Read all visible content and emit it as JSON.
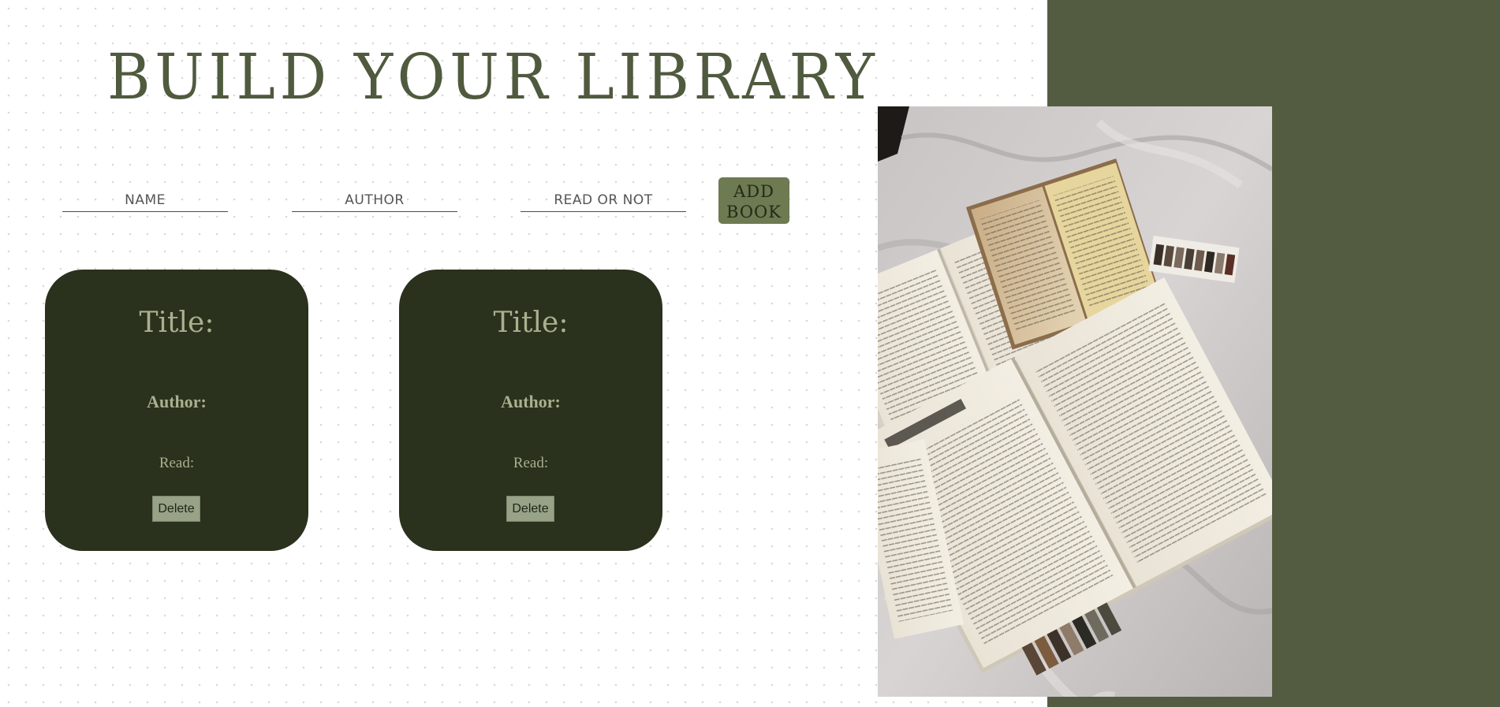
{
  "header": {
    "title": "BUILD YOUR LIBRARY"
  },
  "form": {
    "name_placeholder": "NAME",
    "author_placeholder": "AUTHOR",
    "read_placeholder": "READ OR NOT",
    "add_button_line1": "ADD",
    "add_button_line2": "BOOK"
  },
  "cards": [
    {
      "title_label": "Title:",
      "author_label": "Author:",
      "read_label": "Read:",
      "delete_label": "Delete"
    },
    {
      "title_label": "Title:",
      "author_label": "Author:",
      "read_label": "Read:",
      "delete_label": "Delete"
    }
  ],
  "image": {
    "icon": "open-books-photo"
  },
  "colors": {
    "accent_panel": "#535c41",
    "title_text": "#4f5a3e",
    "card_bg": "#2a311d",
    "card_text": "#a9b08e",
    "add_button": "#6d7a52",
    "delete_button": "#97a286"
  }
}
